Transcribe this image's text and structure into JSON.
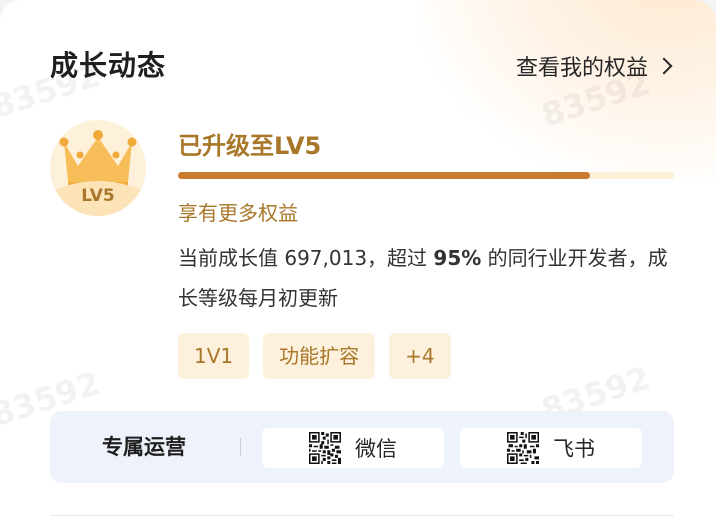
{
  "header": {
    "title": "成长动态",
    "view_rights_label": "查看我的权益"
  },
  "level": {
    "badge_text": "LV5",
    "title": "已升级至LV5",
    "progress_fraction": 0.83,
    "subtitle": "享有更多权益"
  },
  "description": {
    "prefix": "当前成长值 697,013，超过 ",
    "highlight": "95%",
    "suffix": " 的同行业开发者，成长等级每月初更新"
  },
  "chips": [
    "1V1",
    "功能扩容",
    "+4"
  ],
  "operations": {
    "label": "专属运营",
    "wechat_label": "微信",
    "feishu_label": "飞书"
  },
  "watermark": "83592",
  "colors": {
    "gold": "#a8772a",
    "progress": "#c97b2f",
    "chip_bg": "#fdf1dd",
    "ops_bg": "#eef2fb"
  },
  "icons": [
    "crown-icon",
    "chevron-right-icon",
    "qr-code-icon"
  ]
}
